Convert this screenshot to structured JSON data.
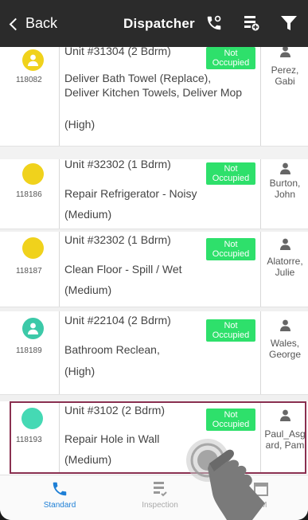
{
  "header": {
    "back_label": "Back",
    "title": "Dispatcher"
  },
  "rows": [
    {
      "id": "118082",
      "unit": "Unit #31304 (2 Bdrm)",
      "status": "Not Occupied",
      "task": "Deliver Bath Towel (Replace), Deliver Kitchen Towels, Deliver Mop",
      "priority": "(High)",
      "assignee": "Perez, Gabi",
      "avatar_color": "#f0d21c"
    },
    {
      "id": "118186",
      "unit": "Unit #32302 (1 Bdrm)",
      "status": "Not Occupied",
      "task": "Repair Refrigerator - Noisy",
      "priority": "(Medium)",
      "assignee": "Burton, John",
      "avatar_color": "#f0d21c"
    },
    {
      "id": "118187",
      "unit": "Unit #32302 (1 Bdrm)",
      "status": "Not Occupied",
      "task": "Clean Floor - Spill / Wet",
      "priority": "(Medium)",
      "assignee": "Alatorre, Julie",
      "avatar_color": "#f0d21c"
    },
    {
      "id": "118189",
      "unit": "Unit #22104 (2 Bdrm)",
      "status": "Not Occupied",
      "task": "Bathroom Reclean,",
      "priority": "(High)",
      "assignee": "Wales, George",
      "avatar_color": "#3cc9a8"
    },
    {
      "id": "118193",
      "unit": "Unit #3102 (2 Bdrm)",
      "status": "Not Occupied",
      "task": "Repair Hole in Wall",
      "priority": "(Medium)",
      "assignee": "Paul_Asgard, Pam",
      "avatar_color": "#45d9b4"
    }
  ],
  "tabs": [
    {
      "label": "Standard",
      "icon": "phone-icon"
    },
    {
      "label": "Inspection",
      "icon": "checklist-icon"
    },
    {
      "label": "PM",
      "icon": "calendar-icon"
    }
  ],
  "colors": {
    "accent": "#1e7fd6",
    "status_green": "#2ee06b",
    "selection_border": "#8a3050",
    "header_bg": "#2b2b2b"
  }
}
